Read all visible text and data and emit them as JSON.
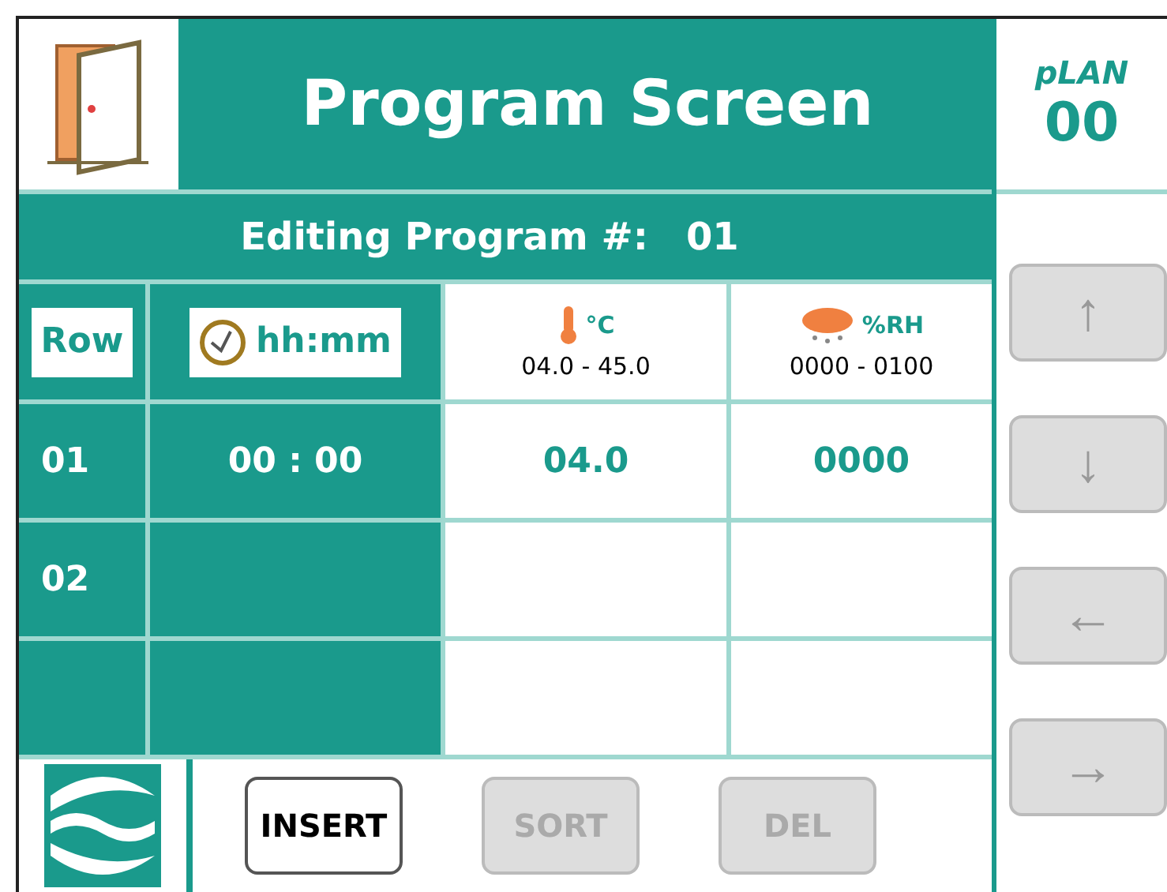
{
  "header": {
    "title": "Program Screen",
    "plan_label": "pLAN",
    "plan_value": "00"
  },
  "editing": {
    "label": "Editing Program #:",
    "value": "01"
  },
  "table": {
    "columns": [
      {
        "kind": "row",
        "label": "Row"
      },
      {
        "kind": "time",
        "label": "hh:mm"
      },
      {
        "kind": "temp",
        "label": "°C",
        "range": "04.0 - 45.0"
      },
      {
        "kind": "humidity",
        "label": "%RH",
        "range": "0000 - 0100"
      }
    ],
    "rows": [
      {
        "row": "01",
        "time": "00 : 00",
        "temp": "04.0",
        "humidity": "0000"
      },
      {
        "row": "02",
        "time": "",
        "temp": "",
        "humidity": ""
      },
      {
        "row": "",
        "time": "",
        "temp": "",
        "humidity": ""
      }
    ]
  },
  "arrows": [
    "↑",
    "↓",
    "←",
    "→"
  ],
  "buttons": [
    {
      "label": "INSERT",
      "disabled": false
    },
    {
      "label": "SORT",
      "disabled": true
    },
    {
      "label": "DEL",
      "disabled": true
    }
  ]
}
